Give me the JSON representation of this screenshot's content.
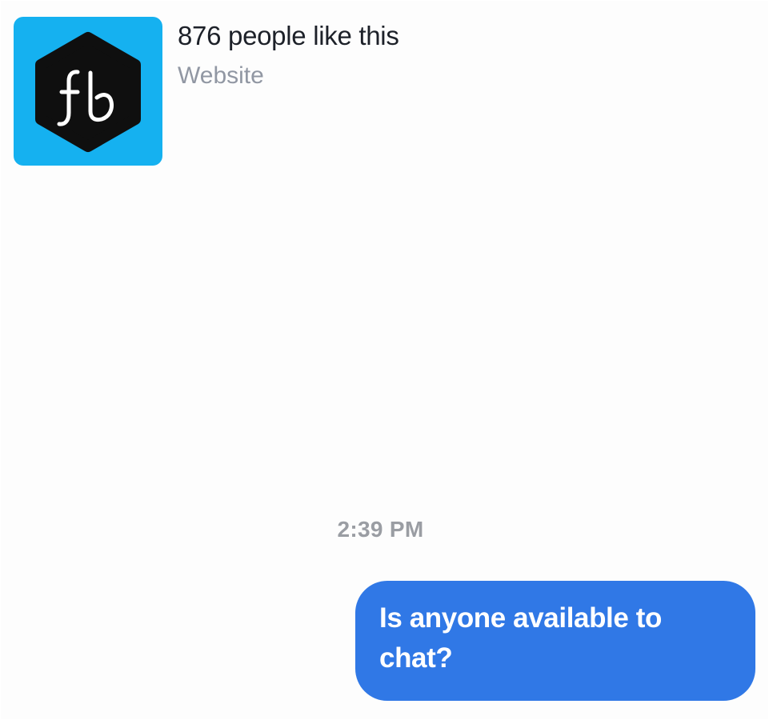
{
  "page": {
    "avatar_logo_text": "fb",
    "likes_text": "876 people like this",
    "category": "Website",
    "colors": {
      "avatar_background": "#15b1f0",
      "hexagon": "#0f0f0f",
      "bubble": "#3078e6",
      "timestamp": "#9a9da3",
      "category": "#9197a3"
    }
  },
  "conversation": {
    "timestamp": "2:39 PM",
    "messages": [
      {
        "sender": "self",
        "text": "Is anyone available to chat?"
      }
    ]
  }
}
